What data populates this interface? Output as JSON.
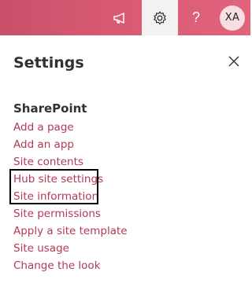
{
  "topbar": {
    "icons": [
      "megaphone-icon",
      "gear-icon",
      "help-icon"
    ],
    "help_glyph": "?",
    "avatar_initials": "XA",
    "colors": {
      "bar": "#d85a72",
      "active_slot": "#f3f2f1",
      "avatar_bg": "#f8dde3"
    }
  },
  "panel": {
    "title": "Settings",
    "close_icon": "close-icon",
    "section_title": "SharePoint",
    "link_color": "#b33a55",
    "links": [
      "Add a page",
      "Add an app",
      "Site contents",
      "Hub site settings",
      "Site information",
      "Site permissions",
      "Apply a site template",
      "Site usage",
      "Change the look"
    ],
    "highlighted_links": [
      "Hub site settings",
      "Site information"
    ]
  }
}
